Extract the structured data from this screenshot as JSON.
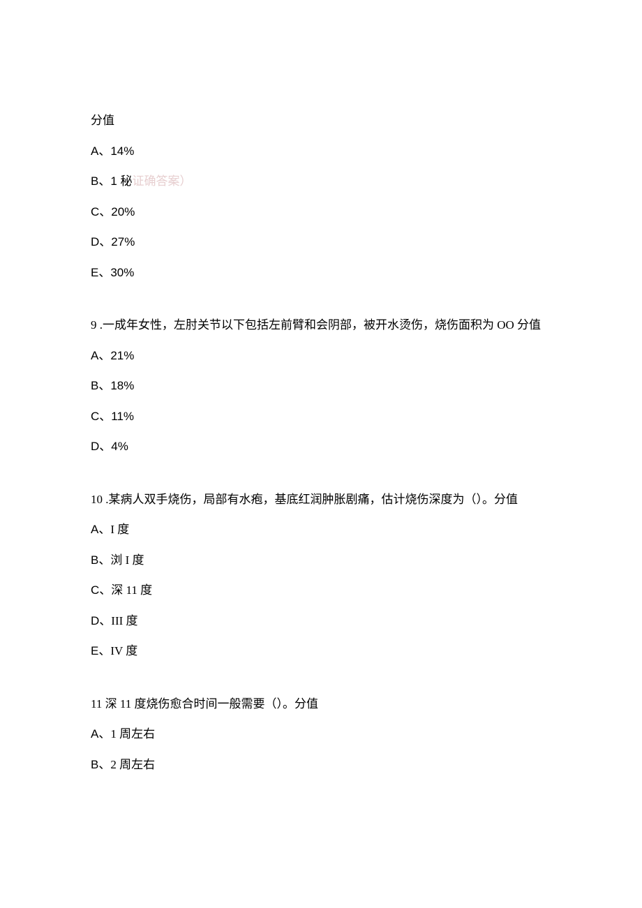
{
  "q8_tail": {
    "score_label": "分值",
    "options": {
      "A": {
        "label": "A、",
        "text": "14%"
      },
      "B": {
        "label_prefix": "B、1 秘",
        "pale_text": "证确答案）"
      },
      "C": {
        "label": "C、",
        "text": "20%"
      },
      "D": {
        "label": "D、",
        "text": "27%"
      },
      "E": {
        "label": "E、",
        "text": "30%"
      }
    }
  },
  "q9": {
    "number": "9",
    "stem": " .一成年女性，左肘关节以下包括左前臂和会阴部，被开水烫伤，烧伤面积为 OO 分值",
    "options": {
      "A": {
        "label": "A、",
        "text": "21%"
      },
      "B": {
        "label": "B、",
        "text": "18%"
      },
      "C": {
        "label": "C、",
        "text": "11%"
      },
      "D": {
        "label": "D、",
        "text": "4%"
      }
    }
  },
  "q10": {
    "number": "10",
    "stem": " .某病人双手烧伤，局部有水疱，基底红润肿胀剧痛，估计烧伤深度为（）。分值",
    "options": {
      "A": {
        "label": "A、",
        "text": "I 度"
      },
      "B": {
        "label": "B、",
        "text": "浏 I 度"
      },
      "C": {
        "label": "C、",
        "text": "深 11 度"
      },
      "D": {
        "label": "D、",
        "text": "III 度"
      },
      "E": {
        "label": "E、",
        "text": "IV 度"
      }
    }
  },
  "q11": {
    "stem": "11 深 11 度烧伤愈合时间一般需要（）。分值",
    "options": {
      "A": {
        "label": "A、",
        "text": "1 周左右"
      },
      "B": {
        "label": "B、",
        "text": "2 周左右"
      }
    }
  }
}
